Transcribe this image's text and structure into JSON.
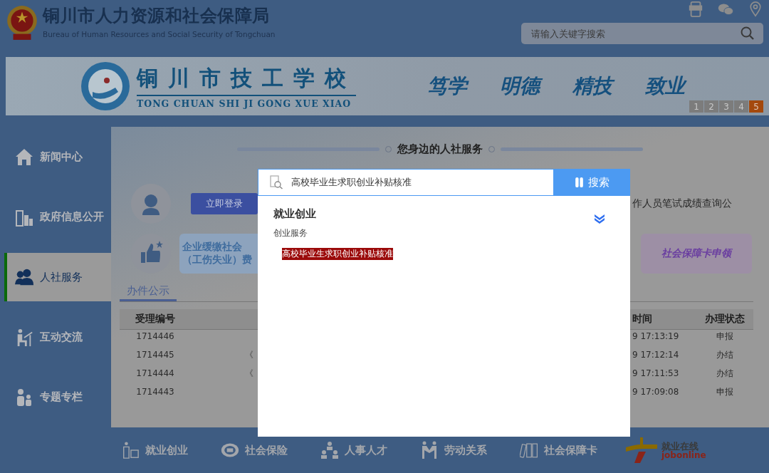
{
  "header": {
    "title": "铜川市人力资源和社会保障局",
    "subtitle": "Bureau of Human Resources and Social Security of Tongchuan",
    "search": {
      "placeholder": "请输入关键字搜索"
    }
  },
  "banner": {
    "school_name": "铜川市技工学校",
    "school_pinyin": "TONG CHUAN SHI JI GONG XUE XIAO",
    "slogans": [
      "笃学",
      "明德",
      "精技",
      "致业"
    ],
    "pager": [
      {
        "label": "1",
        "selected": false
      },
      {
        "label": "2",
        "selected": false
      },
      {
        "label": "3",
        "selected": false
      },
      {
        "label": "4",
        "selected": false
      },
      {
        "label": "5",
        "selected": true
      }
    ]
  },
  "sidebar": {
    "items": [
      {
        "label": "新闻中心",
        "selected": false,
        "kind": "house"
      },
      {
        "label": "政府信息公开",
        "selected": false,
        "kind": "buildings"
      },
      {
        "label": "人社服务",
        "selected": true,
        "kind": "people"
      },
      {
        "label": "互动交流",
        "selected": false,
        "kind": "desk"
      },
      {
        "label": "专题专栏",
        "selected": false,
        "kind": "family"
      }
    ]
  },
  "services": {
    "heading": "您身边的人社服务",
    "login_button": "立即登录",
    "notice": "作人员笔试成绩查询公",
    "cards": [
      {
        "lines": [
          "企业缓缴社会",
          "（工伤失业）费"
        ],
        "kind": "blue"
      },
      {
        "lines": [
          "社会保障卡申领"
        ],
        "kind": "purple"
      }
    ]
  },
  "tabs": [
    {
      "label": "办件公示",
      "selected": true
    }
  ],
  "table": {
    "columns": [
      "受理编号",
      "时间",
      "办理状态"
    ],
    "rows": [
      {
        "number": "1714446",
        "time": "9 17:13:19",
        "status": "申报"
      },
      {
        "number": "1714445",
        "column_2": "《",
        "time": "9 17:12:14",
        "status": "办结"
      },
      {
        "number": "1714444",
        "column_2": "《",
        "time": "9 17:11:53",
        "status": "办结"
      },
      {
        "number": "1714443",
        "time": "9 17:09:08",
        "status": "申报"
      }
    ]
  },
  "bottom_nav": [
    {
      "label": "就业创业",
      "kind": "teacher"
    },
    {
      "label": "社会保险",
      "kind": "si"
    },
    {
      "label": "人事人才",
      "kind": "org"
    },
    {
      "label": "劳动关系",
      "kind": "pair"
    },
    {
      "label": "社会保障卡",
      "kind": "binders"
    }
  ],
  "logo": {
    "name": "就业在线",
    "latin": "jobonline"
  },
  "dialog": {
    "search": {
      "value": "高校毕业生求职创业补贴核准"
    },
    "search_button": "搜索",
    "category": "就业创业",
    "subcategory": "创业服务",
    "results": [
      {
        "label": "高校毕业生求职创业补贴核准",
        "highlighted": true
      }
    ]
  }
}
